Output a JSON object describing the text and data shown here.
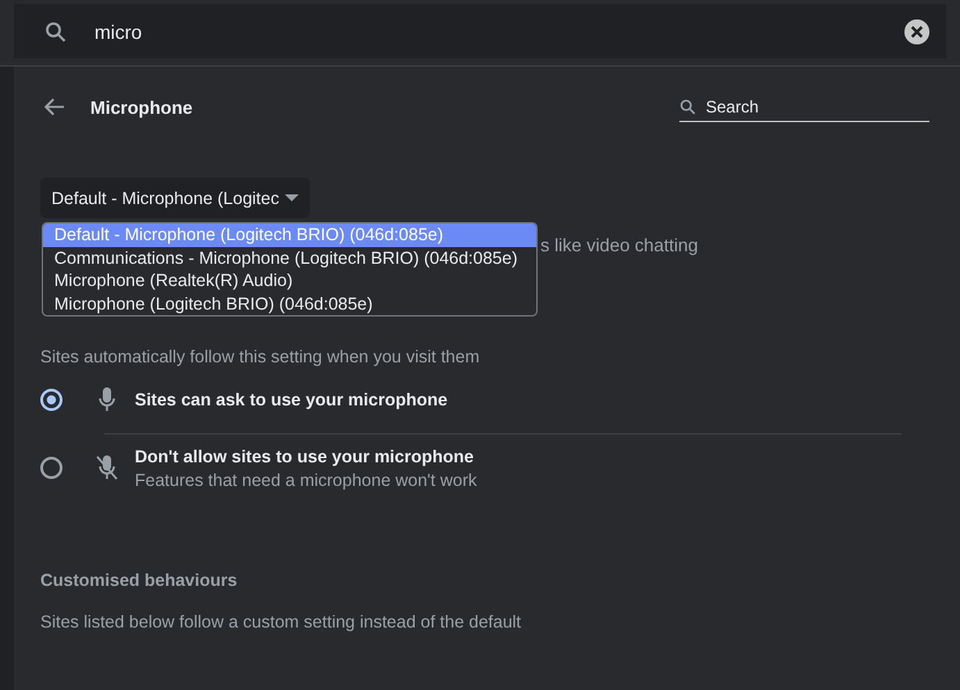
{
  "search": {
    "value": "micro"
  },
  "header": {
    "title": "Microphone",
    "search_placeholder": "Search"
  },
  "device_select": {
    "value": "Default - Microphone (Logitec",
    "expanded": true,
    "options": [
      {
        "label": "Default - Microphone (Logitech BRIO) (046d:085e)",
        "selected": true
      },
      {
        "label": "Communications - Microphone (Logitech BRIO) (046d:085e)",
        "selected": false
      },
      {
        "label": "Microphone (Realtek(R) Audio)",
        "selected": false
      },
      {
        "label": "Microphone (Logitech BRIO) (046d:085e)",
        "selected": false
      }
    ]
  },
  "partial_description": "s like video chatting",
  "default_behaviour": {
    "description": "Sites automatically follow this setting when you visit them",
    "options": [
      {
        "kind": "allow",
        "label": "Sites can ask to use your microphone",
        "selected": true
      },
      {
        "kind": "block",
        "label": "Don't allow sites to use your microphone",
        "sublabel": "Features that need a microphone won't work",
        "selected": false
      }
    ]
  },
  "customised_behaviours": {
    "heading": "Customised behaviours",
    "description": "Sites listed below follow a custom setting instead of the default"
  }
}
